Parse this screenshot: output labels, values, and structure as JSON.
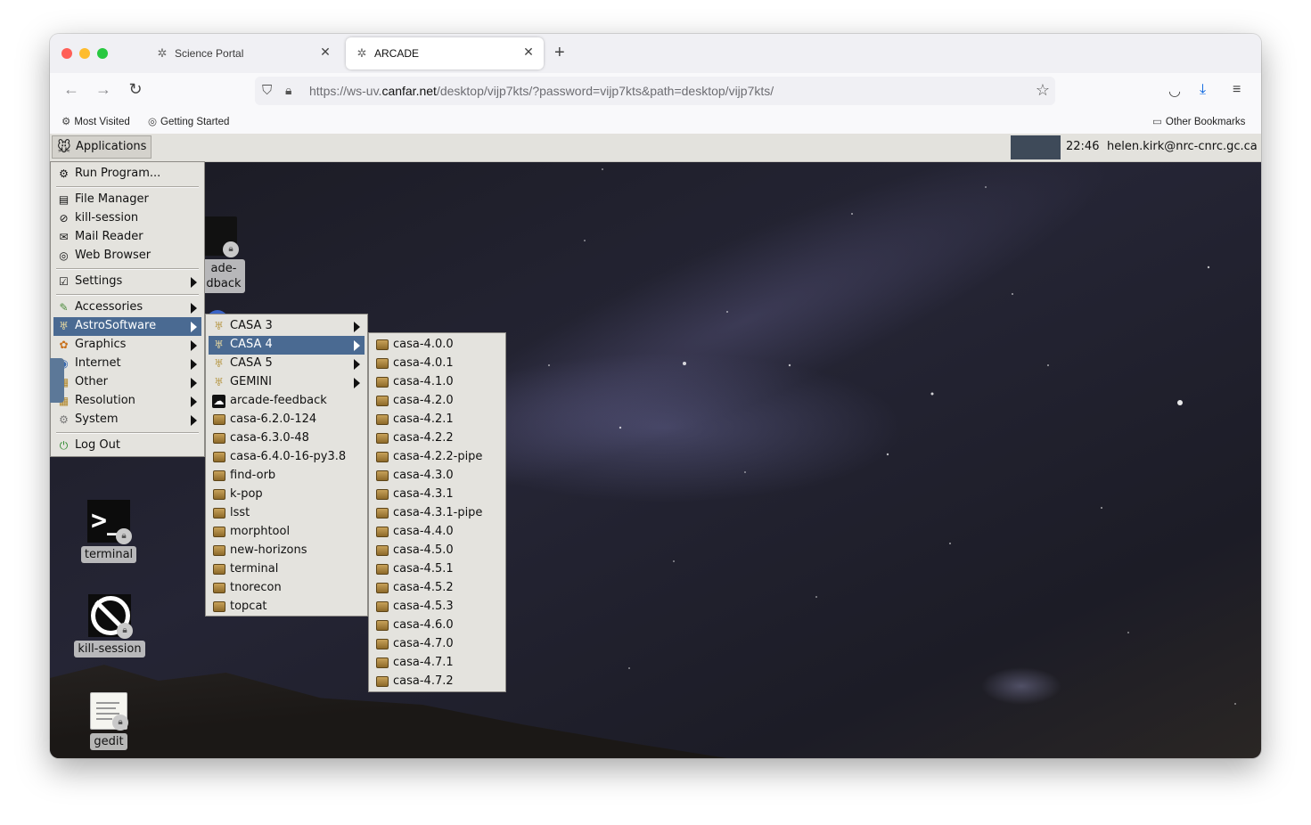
{
  "browser": {
    "tabs": [
      {
        "title": "Science Portal",
        "icon": "puzzle-icon",
        "active": false
      },
      {
        "title": "ARCADE",
        "icon": "puzzle-icon",
        "active": true
      }
    ],
    "url_prefix": "https://ws-uv.",
    "url_host": "canfar.net",
    "url_path": "/desktop/vijp7kts/?password=vijp7kts&path=desktop/vijp7kts/",
    "bookmarks": [
      "Most Visited",
      "Getting Started"
    ],
    "other_bookmarks": "Other Bookmarks"
  },
  "panel": {
    "applications_label": "Applications",
    "clock": "22:46",
    "user": "helen.kirk@nrc-cnrc.gc.ca"
  },
  "desktop_icons": {
    "arcade_feedback": {
      "line1": "ade-",
      "line2": "dback"
    },
    "terminal": "terminal",
    "kill_session": "kill-session",
    "gedit": "gedit"
  },
  "app_menu": {
    "items": [
      {
        "label": "Run Program...",
        "icon": "run-icon"
      },
      {
        "label": "File Manager",
        "icon": "file-manager-icon"
      },
      {
        "label": "kill-session",
        "icon": "kill-session-icon"
      },
      {
        "label": "Mail Reader",
        "icon": "mail-icon"
      },
      {
        "label": "Web Browser",
        "icon": "web-browser-icon"
      },
      {
        "label": "Settings",
        "icon": "settings-icon",
        "submenu": true
      },
      {
        "label": "Accessories",
        "icon": "accessories-icon",
        "submenu": true
      },
      {
        "label": "AstroSoftware",
        "icon": "astro-icon",
        "submenu": true,
        "selected": true
      },
      {
        "label": "Graphics",
        "icon": "graphics-icon",
        "submenu": true
      },
      {
        "label": "Internet",
        "icon": "internet-icon",
        "submenu": true
      },
      {
        "label": "Other",
        "icon": "other-icon",
        "submenu": true
      },
      {
        "label": "Resolution",
        "icon": "resolution-icon",
        "submenu": true
      },
      {
        "label": "System",
        "icon": "system-icon",
        "submenu": true
      },
      {
        "label": "Log Out",
        "icon": "logout-icon"
      }
    ]
  },
  "astro_menu": {
    "items": [
      {
        "label": "CASA 3",
        "submenu": true
      },
      {
        "label": "CASA 4",
        "submenu": true,
        "selected": true
      },
      {
        "label": "CASA 5",
        "submenu": true
      },
      {
        "label": "GEMINI",
        "submenu": true
      },
      {
        "label": "arcade-feedback"
      },
      {
        "label": "casa-6.2.0-124"
      },
      {
        "label": "casa-6.3.0-48"
      },
      {
        "label": "casa-6.4.0-16-py3.8"
      },
      {
        "label": "find-orb"
      },
      {
        "label": "k-pop"
      },
      {
        "label": "lsst"
      },
      {
        "label": "morphtool"
      },
      {
        "label": "new-horizons"
      },
      {
        "label": "terminal"
      },
      {
        "label": "tnorecon"
      },
      {
        "label": "topcat"
      }
    ]
  },
  "casa4_menu": {
    "items": [
      "casa-4.0.0",
      "casa-4.0.1",
      "casa-4.1.0",
      "casa-4.2.0",
      "casa-4.2.1",
      "casa-4.2.2",
      "casa-4.2.2-pipe",
      "casa-4.3.0",
      "casa-4.3.1",
      "casa-4.3.1-pipe",
      "casa-4.4.0",
      "casa-4.5.0",
      "casa-4.5.1",
      "casa-4.5.2",
      "casa-4.5.3",
      "casa-4.6.0",
      "casa-4.7.0",
      "casa-4.7.1",
      "casa-4.7.2"
    ]
  },
  "colors": {
    "menu_bg": "#e4e3de",
    "menu_selected": "#4a6a92",
    "panel_bg": "#e3e2dd",
    "desktop_sky": "#1e1e28"
  }
}
